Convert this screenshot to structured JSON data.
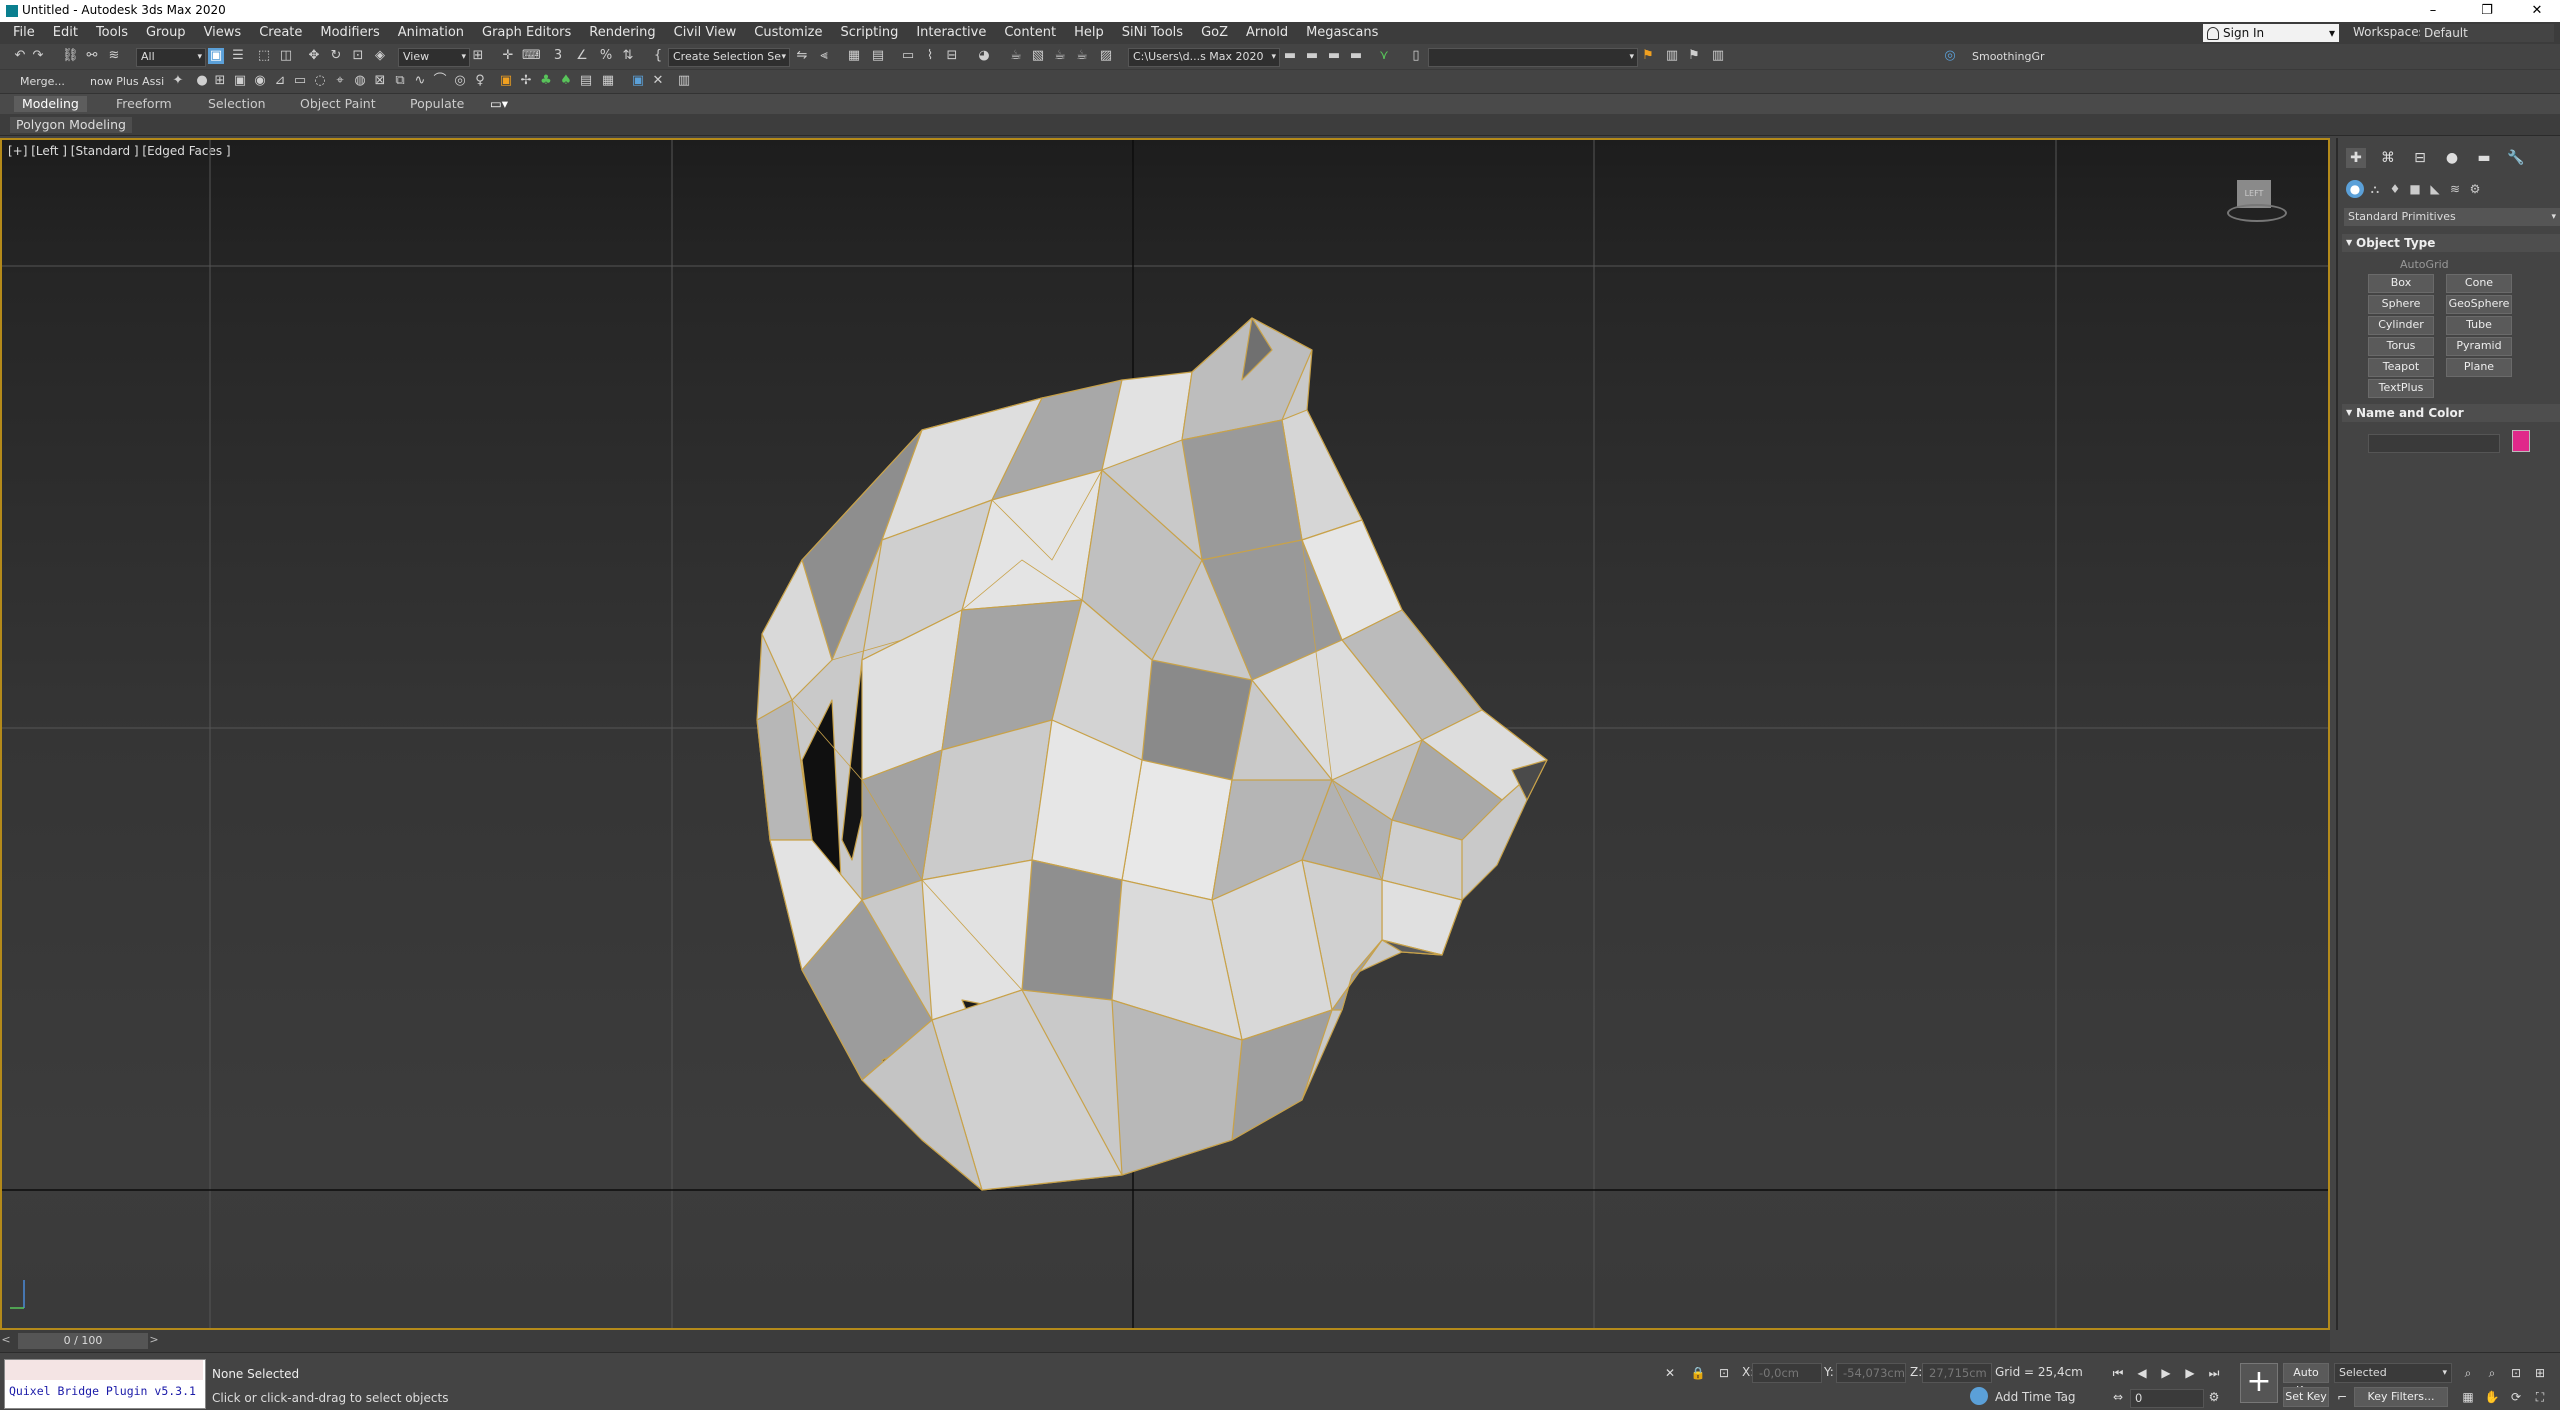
{
  "window": {
    "title": "Untitled - Autodesk 3ds Max 2020",
    "minimize": "–",
    "restore": "❐",
    "close": "✕"
  },
  "menu": [
    "File",
    "Edit",
    "Tools",
    "Group",
    "Views",
    "Create",
    "Modifiers",
    "Animation",
    "Graph Editors",
    "Rendering",
    "Civil View",
    "Customize",
    "Scripting",
    "Interactive",
    "Content",
    "Help",
    "SiNi Tools",
    "GoZ",
    "Arnold",
    "Megascans"
  ],
  "account": {
    "sign_in": "Sign In",
    "workspaces_label": "Workspaces:",
    "workspace": "Default"
  },
  "toolbar1": {
    "filter": "All",
    "ref_coord": "View",
    "named_selection": "Create Selection Se",
    "project_path": "C:\\Users\\d...s Max 2020",
    "smoothing": "SmoothingGr"
  },
  "toolbar2": {
    "merge": "Merge...",
    "plugin": "now Plus Assi"
  },
  "ribbon": {
    "tabs": [
      "Modeling",
      "Freeform",
      "Selection",
      "Object Paint",
      "Populate"
    ],
    "active_panel": "Polygon Modeling"
  },
  "viewport": {
    "label": "[+] [Left ] [Standard ] [Edged Faces ]",
    "viewcube": "LEFT"
  },
  "command_panel": {
    "category": "Standard Primitives",
    "object_type_title": "Object Type",
    "autogrid": "AutoGrid",
    "buttons": [
      "Box",
      "Cone",
      "Sphere",
      "GeoSphere",
      "Cylinder",
      "Tube",
      "Torus",
      "Pyramid",
      "Teapot",
      "Plane",
      "TextPlus"
    ],
    "name_color_title": "Name and Color",
    "object_color": "#e0288a"
  },
  "timeline": {
    "frame": "0 / 100",
    "prev": "<",
    "next": ">"
  },
  "status": {
    "maxscript_output": "Quixel Bridge Plugin v5.3.1",
    "selection": "None Selected",
    "prompt": "Click or click-and-drag to select objects",
    "x_label": "X:",
    "x_value": "-0,0cm",
    "y_label": "Y:",
    "y_value": "-54,073cm",
    "z_label": "Z:",
    "z_value": "27,715cm",
    "grid": "Grid = 25,4cm",
    "add_time_tag": "Add Time Tag",
    "current_frame": "0",
    "auto_key": "Auto Key",
    "set_key": "Set Key",
    "key_mode": "Selected",
    "key_filters": "Key Filters..."
  },
  "colors": {
    "accent": "#b48a1a",
    "active_blue": "#5ba0d8"
  }
}
